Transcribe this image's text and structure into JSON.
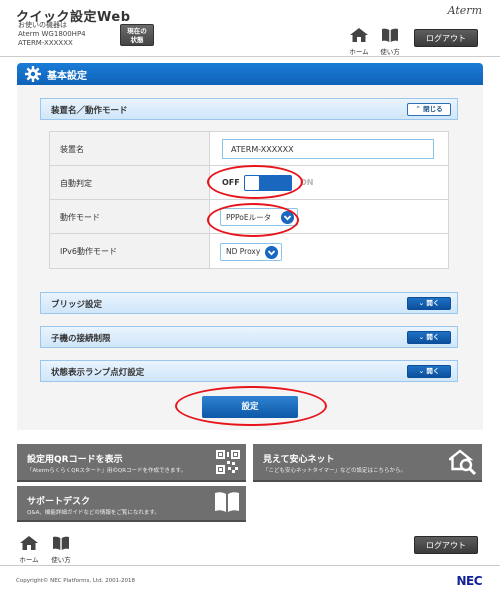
{
  "header": {
    "app_title": "クイック設定Web",
    "device_line1": "お使いの機器は",
    "device_line2": "Aterm WG1800HP4",
    "device_line3": "ATERM-XXXXXX",
    "status_button_line1": "現在の",
    "status_button_line2": "状態",
    "brand_logo": "Aterm",
    "home_label": "ホーム",
    "manual_label": "使い方",
    "logout_label": "ログアウト"
  },
  "page_title": "基本設定",
  "sections": {
    "device": {
      "label": "装置名／動作モード",
      "button": "閉じる"
    },
    "bridge": {
      "label": "ブリッジ設定",
      "button": "開く"
    },
    "child": {
      "label": "子機の接続制限",
      "button": "開く"
    },
    "lamp": {
      "label": "状態表示ランプ点灯設定",
      "button": "開く"
    }
  },
  "form": {
    "device_name_label": "装置名",
    "device_name_value": "ATERM-XXXXXX",
    "auto_detect_label": "自動判定",
    "toggle_off": "OFF",
    "toggle_on": "ON",
    "auto_detect_state": "OFF",
    "mode_label": "動作モード",
    "mode_value": "PPPoEルータ",
    "ipv6_label": "IPv6動作モード",
    "ipv6_value": "ND Proxy"
  },
  "submit_label": "設定",
  "tiles": {
    "qr": {
      "title": "設定用QRコードを表示",
      "desc": "「AtermらくらくQRスタート」用のQRコードを作成できます。"
    },
    "safety": {
      "title": "見えて安心ネット",
      "desc": "「こども安心ネットタイマー」などの設定はこちらから。"
    },
    "support": {
      "title": "サポートデスク",
      "desc": "Q&A、機能詳細ガイドなどの情報をご覧になれます。"
    }
  },
  "footer": {
    "home_label": "ホーム",
    "manual_label": "使い方",
    "logout_label": "ログアウト",
    "copyright": "Copyright© NEC Platforms, Ltd. 2001-2018",
    "company_logo": "NEC"
  },
  "colors": {
    "accent_blue": "#1a67c0",
    "annotation_red": "#e8141b",
    "tile_gray": "#6f6f6f"
  },
  "icons": {
    "home": "home-icon",
    "manual": "book-icon",
    "settings": "gear-icon",
    "qr": "qr-code-icon",
    "safety": "house-search-icon",
    "support": "book-icon",
    "chevron": "chevron-down-icon"
  }
}
